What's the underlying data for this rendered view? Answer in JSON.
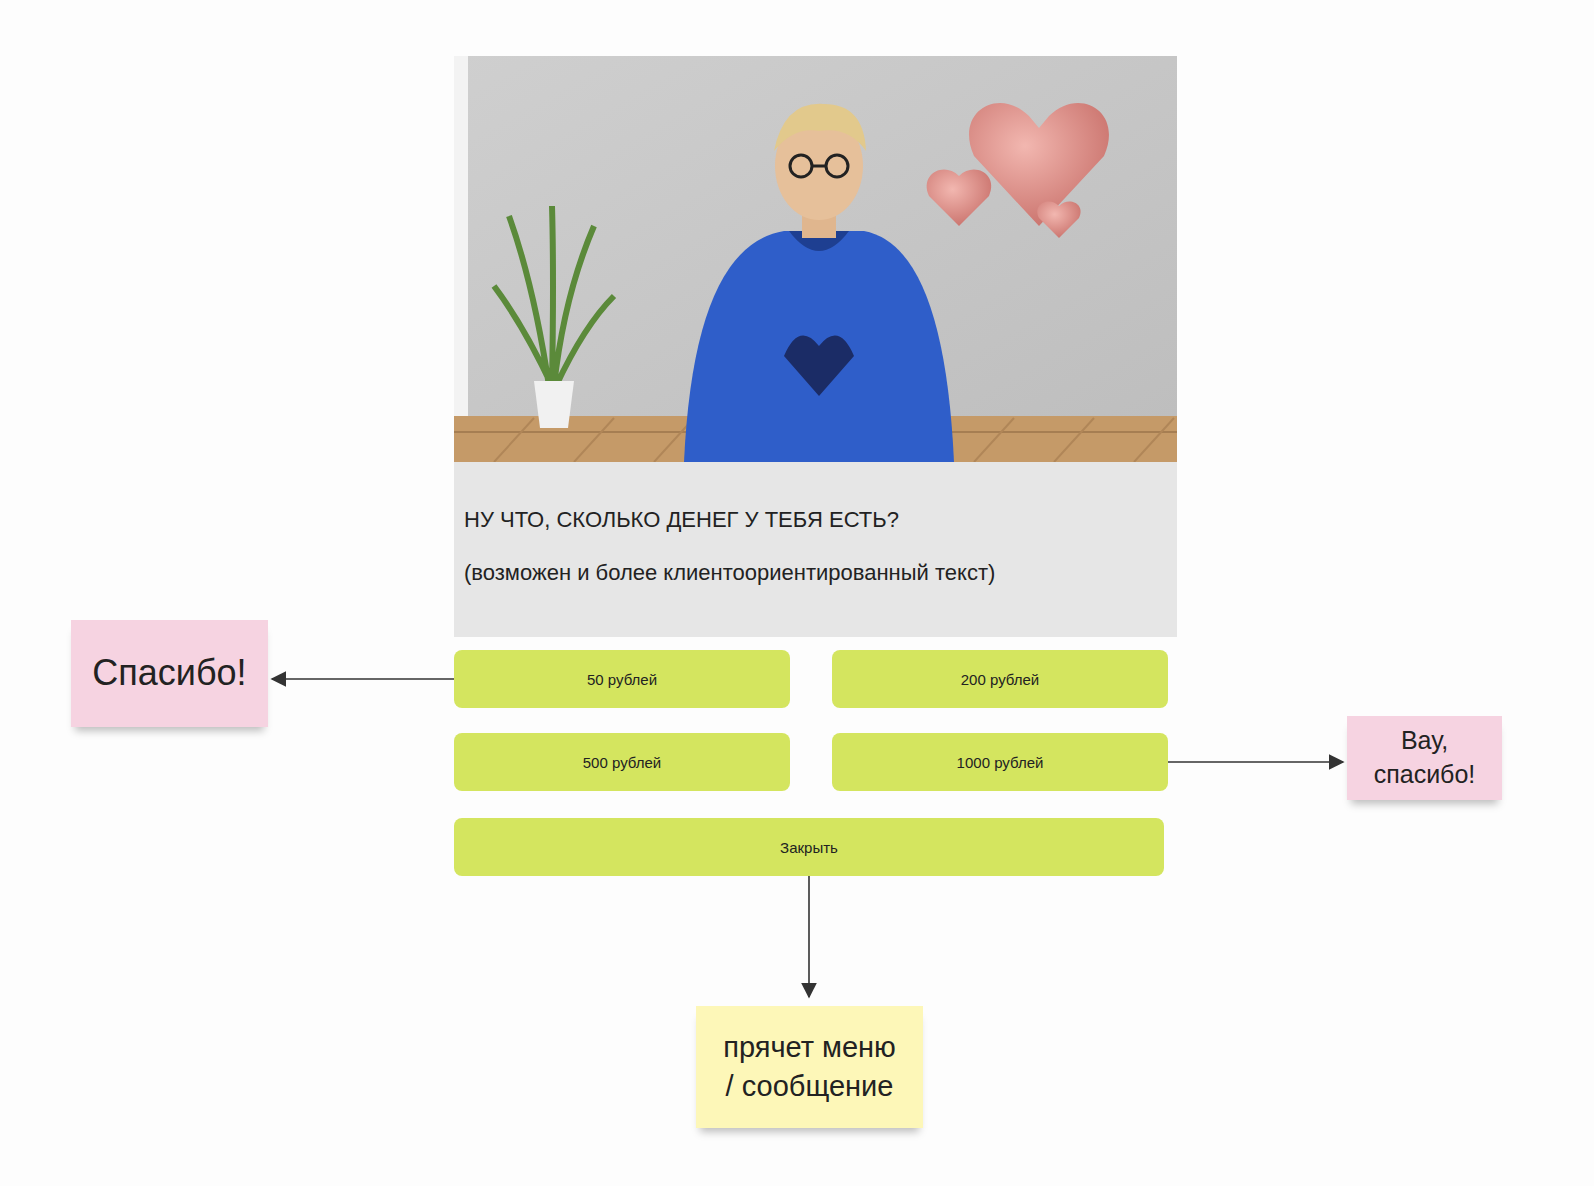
{
  "dialog": {
    "message": "НУ ЧТО, СКОЛЬКО ДЕНЕГ У ТЕБЯ ЕСТЬ?",
    "note": "(возможен и более клиентоориентированный текст)",
    "options": [
      {
        "label": "50 рублей"
      },
      {
        "label": "200 рублей"
      },
      {
        "label": "500 рублей"
      },
      {
        "label": "1000 рублей"
      }
    ],
    "close": "Закрыть"
  },
  "stickies": [
    {
      "text": "Спасибо!",
      "color": "#f6d3e1"
    },
    {
      "text": "Вау, спасибо!",
      "color": "#f6d3e1"
    },
    {
      "text": "прячет меню / сообщение",
      "color": "#fdf7b8"
    }
  ]
}
